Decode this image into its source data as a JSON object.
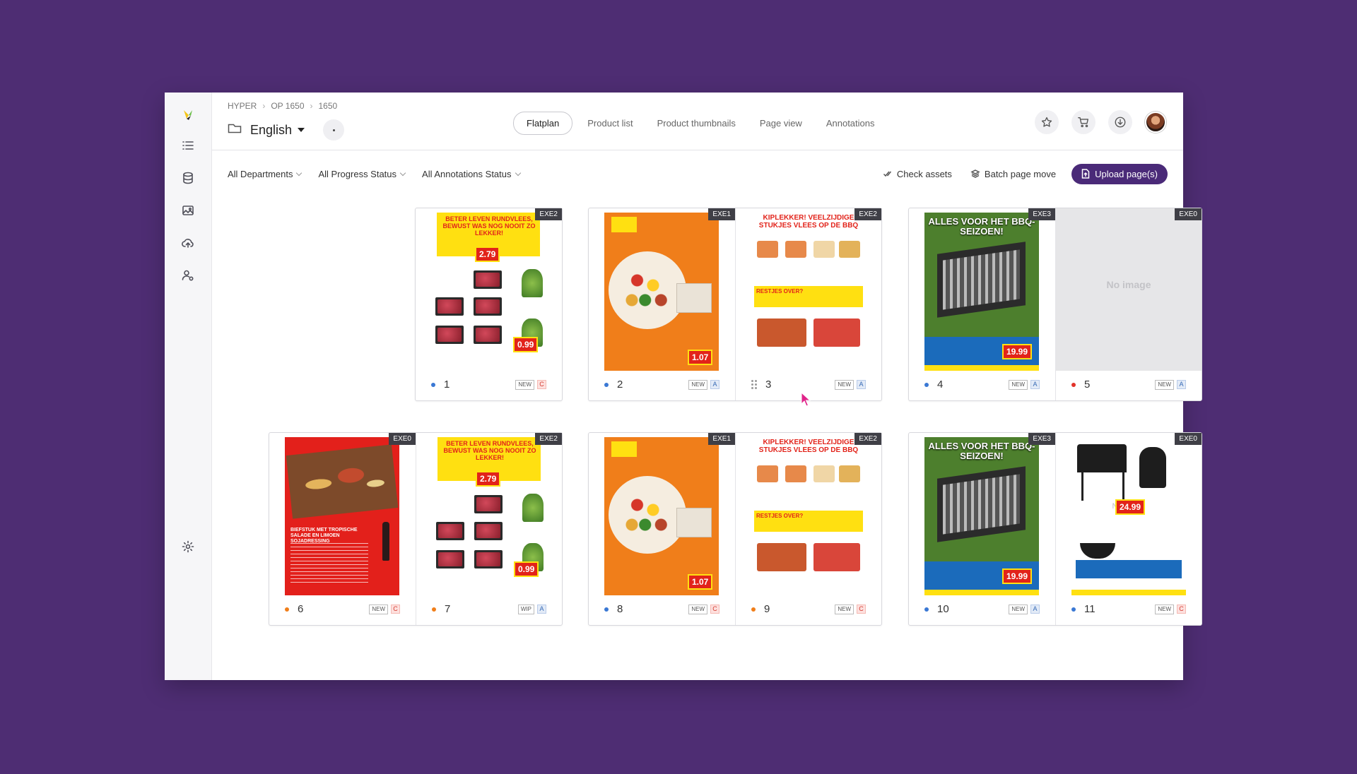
{
  "breadcrumb": [
    "HYPER",
    "OP 1650",
    "1650"
  ],
  "title": "English",
  "tabs": [
    "Flatplan",
    "Product list",
    "Product thumbnails",
    "Page view",
    "Annotations"
  ],
  "filters": [
    "All Departments",
    "All Progress Status",
    "All Annotations Status"
  ],
  "actions": {
    "check_assets": "Check assets",
    "batch_move": "Batch page move",
    "upload": "Upload page(s)"
  },
  "no_image": "No image",
  "badge_new": "NEW",
  "badge_wip": "WIP",
  "colors": {
    "background": "#4e2d73",
    "accent": "#4a2a78",
    "dot_blue": "#3a78d4",
    "dot_red": "#e2332a",
    "dot_orange": "#f07e1a"
  },
  "pages": [
    {
      "num": "1",
      "exe": "EXE2",
      "status": "NEW",
      "letter": "C",
      "dot": "blue"
    },
    {
      "num": "2",
      "exe": "EXE1",
      "status": "NEW",
      "letter": "A",
      "dot": "blue"
    },
    {
      "num": "3",
      "exe": "EXE2",
      "status": "NEW",
      "letter": "A",
      "dot": "drag"
    },
    {
      "num": "4",
      "exe": "EXE3",
      "status": "NEW",
      "letter": "A",
      "dot": "blue"
    },
    {
      "num": "5",
      "exe": "EXE0",
      "status": "NEW",
      "letter": "A",
      "dot": "red"
    },
    {
      "num": "6",
      "exe": "EXE0",
      "status": "NEW",
      "letter": "C",
      "dot": "orange"
    },
    {
      "num": "7",
      "exe": "EXE2",
      "status": "WIP",
      "letter": "A",
      "dot": "orange"
    },
    {
      "num": "8",
      "exe": "EXE1",
      "status": "NEW",
      "letter": "C",
      "dot": "blue"
    },
    {
      "num": "9",
      "exe": "EXE2",
      "status": "NEW",
      "letter": "C",
      "dot": "orange"
    },
    {
      "num": "10",
      "exe": "EXE3",
      "status": "NEW",
      "letter": "A",
      "dot": "blue"
    },
    {
      "num": "11",
      "exe": "EXE0",
      "status": "NEW",
      "letter": "C",
      "dot": "blue"
    }
  ],
  "flyer_text": {
    "meat_title": "BETER LEVEN RUNDVLEES, BEWUST WAS NOG NOOIT ZO LEKKER!",
    "meat_price": "2.79",
    "meat_price2": "0.99",
    "bbq_title": "KIPLEKKER! VEELZIJDIGE STUKJES VLEES OP DE BBQ",
    "bbq_band": "RESTJES OVER?",
    "grill_title": "ALLES VOOR HET BBQ-SEIZOEN!",
    "grill_price": "19.99",
    "orange_price": "1.07",
    "red_title": "BIEFSTUK MET TROPISCHE SALADE EN LIMOEN SOJADRESSING",
    "grill2_price": "24.99"
  }
}
